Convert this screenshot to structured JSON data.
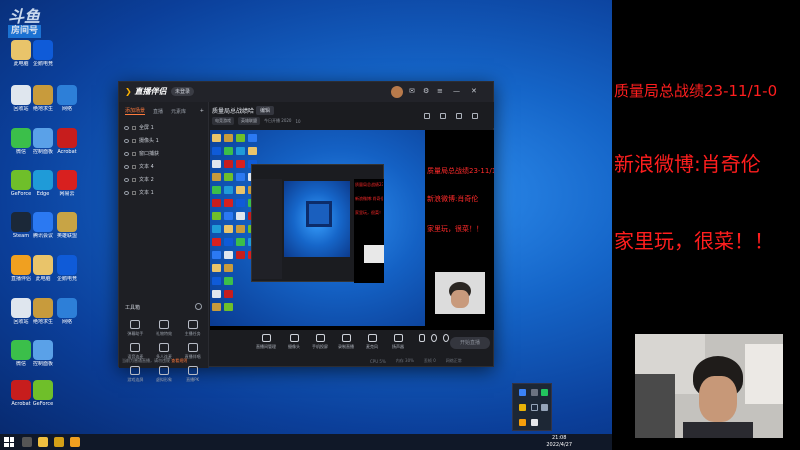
{
  "desktop": {
    "watermark_logo": "斗鱼",
    "watermark_sub": "房间号",
    "icons": [
      {
        "label": "此电脑",
        "color": "#e9c46a"
      },
      {
        "label": "企鹅电竞",
        "color": "#0f5bd8"
      },
      {
        "label": "回收站",
        "color": "#dfe6ee"
      },
      {
        "label": "绝地求生",
        "color": "#c89b3c"
      },
      {
        "label": "网络",
        "color": "#2d7fd8"
      },
      {
        "label": "微信",
        "color": "#3bbf4a"
      },
      {
        "label": "控制面板",
        "color": "#5aa1e8"
      },
      {
        "label": "Acrobat",
        "color": "#c71d1d"
      },
      {
        "label": "GeForce",
        "color": "#6fbf2a"
      },
      {
        "label": "Edge",
        "color": "#1f9bd8"
      },
      {
        "label": "网易云",
        "color": "#d8201f"
      },
      {
        "label": "Steam",
        "color": "#1b2838"
      },
      {
        "label": "腾讯会议",
        "color": "#2b79f2"
      },
      {
        "label": "英雄联盟",
        "color": "#c8a445"
      },
      {
        "label": "直播伴侣",
        "color": "#f0a020"
      }
    ]
  },
  "app": {
    "logo": "直播伴侣",
    "badge": "未登录",
    "side_tabs": [
      "添加场景",
      "直播",
      "元素库"
    ],
    "sources": [
      "全屏 1",
      "摄像头 1",
      "窗口捕获",
      "文本 4",
      "文本 2",
      "文本 1"
    ],
    "tools_header": "工具箱",
    "tools": [
      "弹幕助手",
      "礼物特效",
      "主播任务",
      "语音连麦",
      "多人连麦",
      "直播伴唱",
      "游戏连屏",
      "虚拟形象",
      "直播PK"
    ],
    "side_footer": "当前为普通直播，请勿违规",
    "side_footer_link": "查看规则",
    "room_title": "质量局总战绩哈",
    "edit_label": "编辑",
    "meta_chips": [
      "电竞游戏",
      "英雄联盟"
    ],
    "meta_text": "今日开播 2020",
    "meta_count": "10",
    "preview_overlay": [
      "质量局总战绩23-11/1-0",
      "新浪微博:肖奇伦",
      "家里玩，很菜！！"
    ],
    "controls": [
      "直播间管理",
      "摄像头",
      "手机投屏",
      "录制直播",
      "麦克风",
      "扬声器"
    ],
    "go_live_label": "开始直播",
    "status": [
      "CPU 5%",
      "内存 30%",
      "丢帧 0",
      "网络正常"
    ]
  },
  "overlay": {
    "line1": "质量局总战绩23-11/1-0",
    "line2": "新浪微博:肖奇伦",
    "line3": "家里玩，很菜！！"
  },
  "taskbar": {
    "time": "21:08",
    "date": "2022/4/27"
  }
}
